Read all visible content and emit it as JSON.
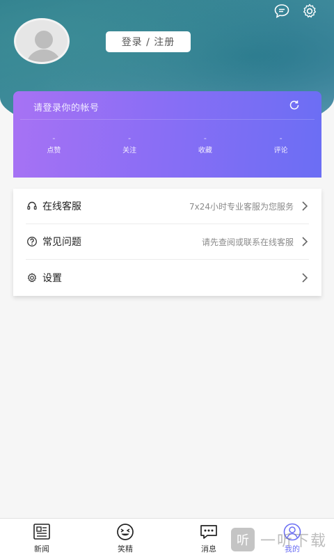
{
  "header": {
    "login_label": "登录 / 注册",
    "icons": [
      "message-icon",
      "settings-gear-icon",
      "avatar-placeholder-icon"
    ]
  },
  "account": {
    "title": "请登录你的帐号",
    "stats": [
      {
        "value": "-",
        "label": "点赞"
      },
      {
        "value": "-",
        "label": "关注"
      },
      {
        "value": "-",
        "label": "收藏"
      },
      {
        "value": "-",
        "label": "评论"
      }
    ]
  },
  "menu": [
    {
      "label": "在线客服",
      "hint": "7x24小时专业客服为您服务",
      "icon": "headset-icon"
    },
    {
      "label": "常见问题",
      "hint": "请先查阅或联系在线客服",
      "icon": "question-icon"
    },
    {
      "label": "设置",
      "hint": "",
      "icon": "gear-icon"
    }
  ],
  "tabs": [
    {
      "label": "新闻",
      "icon": "news-icon"
    },
    {
      "label": "笑精",
      "icon": "laugh-face-icon"
    },
    {
      "label": "消息",
      "icon": "chat-bubble-icon"
    },
    {
      "label": "我的",
      "icon": "profile-icon",
      "active": true
    }
  ],
  "watermark": {
    "badge": "听",
    "text": "一听下载"
  },
  "colors": {
    "accent": "#6b6ef4",
    "card_gradient_start": "#a772f4",
    "card_gradient_end": "#6b6ef4",
    "header_teal": "#3d8a9a"
  }
}
